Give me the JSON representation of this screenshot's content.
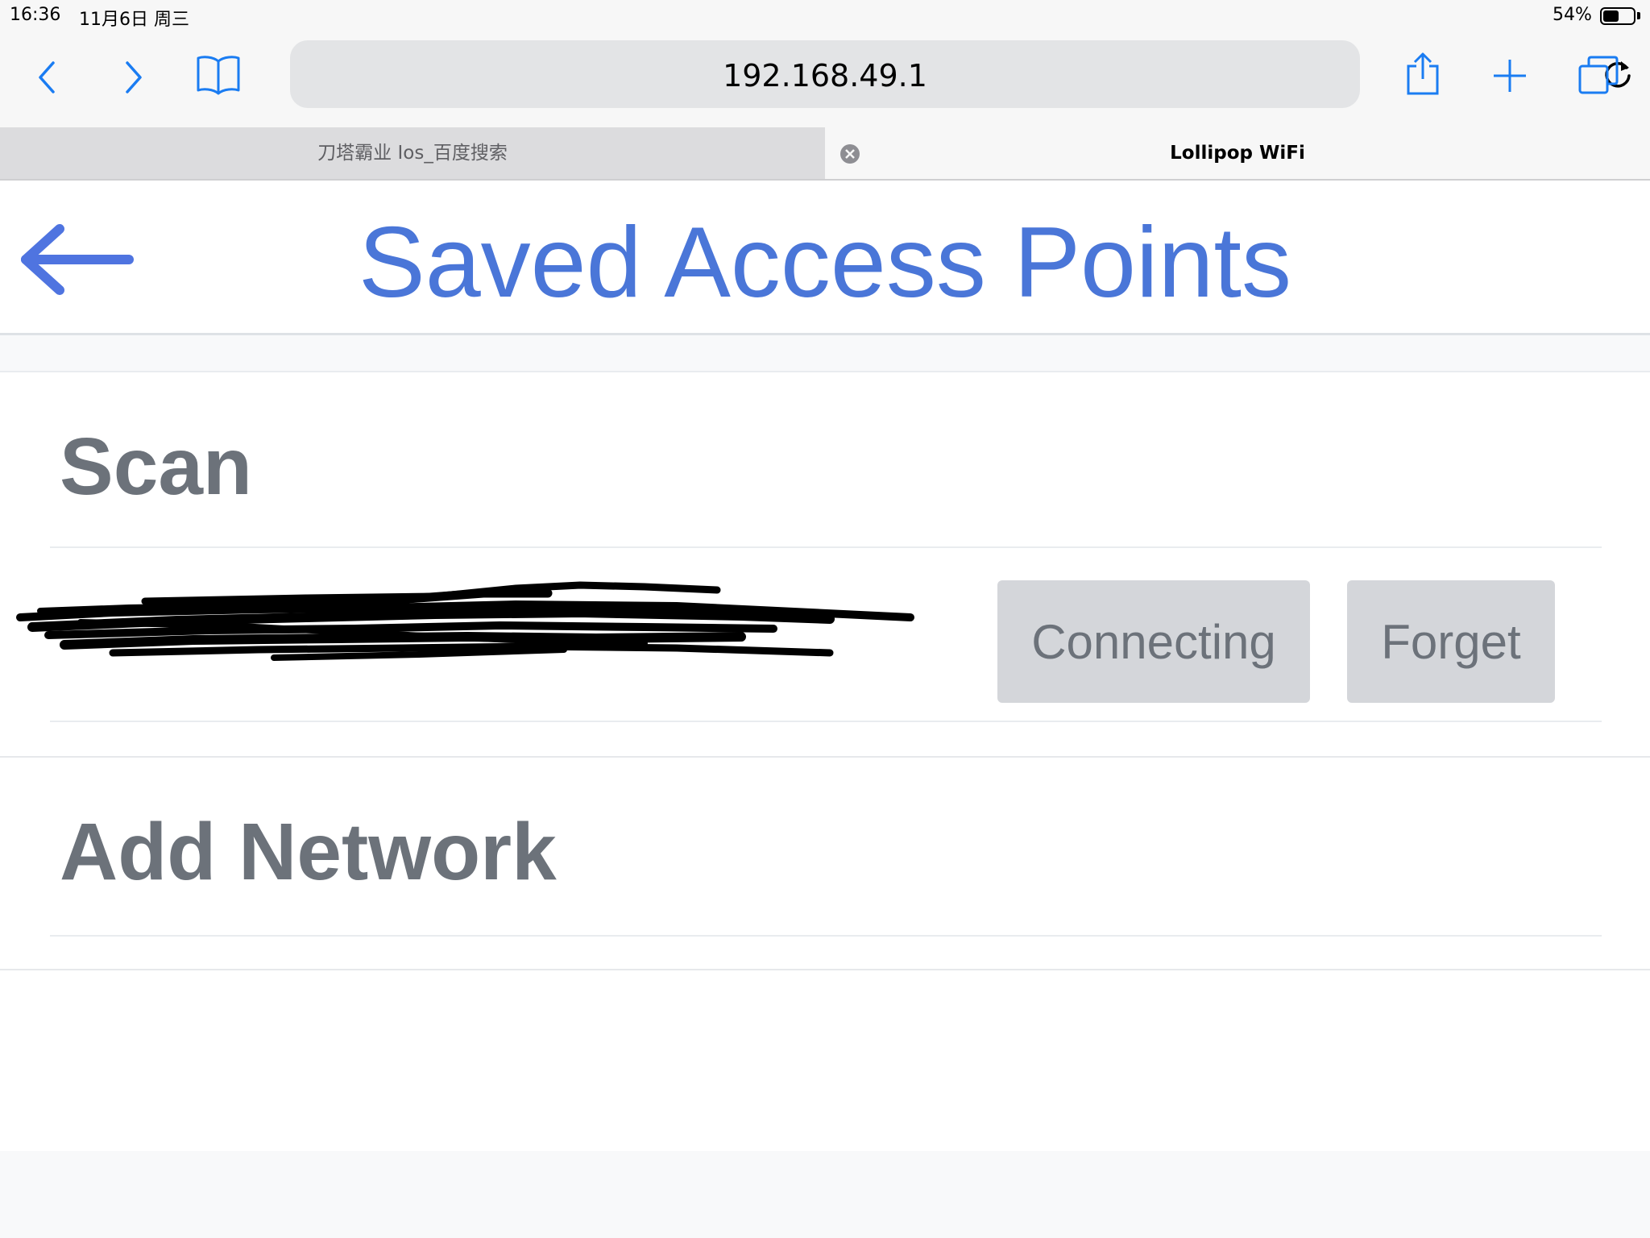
{
  "status_bar": {
    "time": "16:36",
    "date": "11月6日 周三",
    "battery_percent_text": "54%",
    "battery_level": 0.54
  },
  "browser": {
    "address": "192.168.49.1",
    "icons": {
      "back": "chevron-left-icon",
      "forward": "chevron-right-icon",
      "bookmarks": "book-icon",
      "reload": "reload-icon",
      "share": "share-icon",
      "new_tab": "plus-icon",
      "tabs": "tabs-icon"
    },
    "accent_color": "#1a7cf2",
    "tabs": [
      {
        "label": "刀塔霸业 Ios_百度搜索",
        "active": false
      },
      {
        "label": "Lollipop WiFi",
        "active": true
      }
    ]
  },
  "page": {
    "title": "Saved Access Points",
    "title_color": "#4a76d8",
    "back_icon": "arrow-left-icon",
    "sections": {
      "scan_label": "Scan",
      "add_network_label": "Add Network"
    },
    "access_points": [
      {
        "name": "",
        "redacted": true,
        "status_button_label": "Connecting",
        "forget_button_label": "Forget"
      }
    ]
  }
}
